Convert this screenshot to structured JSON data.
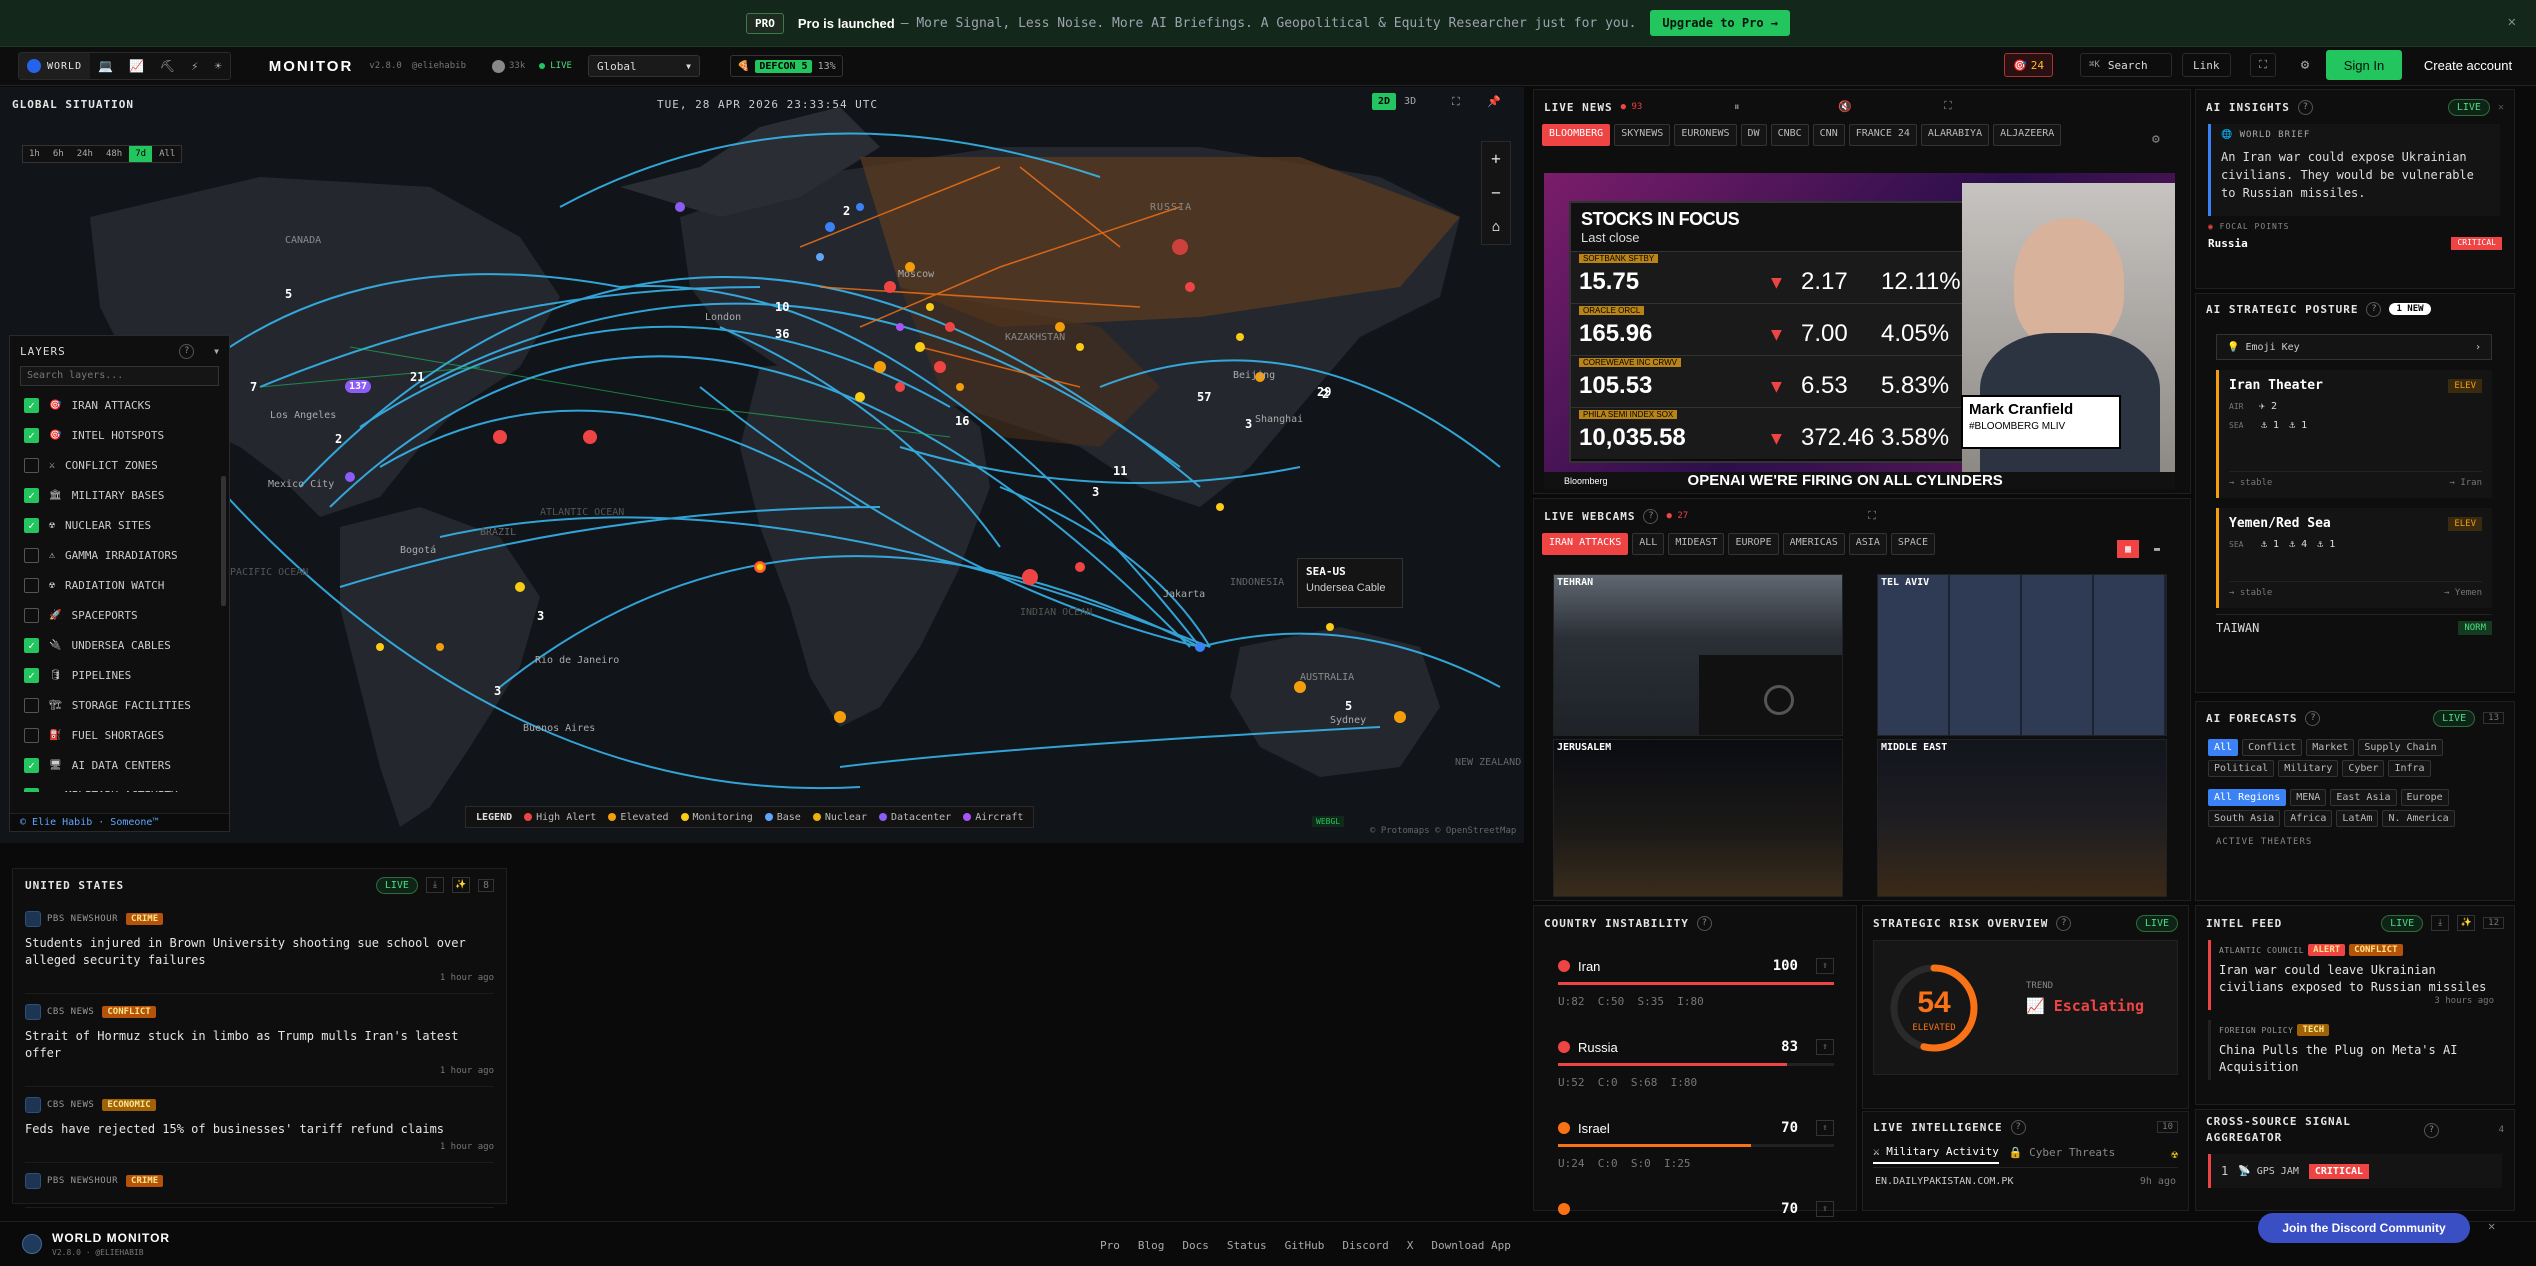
{
  "banner": {
    "tag": "PRO",
    "title": "Pro is launched",
    "text": "— More Signal, Less Noise. More AI Briefings. A Geopolitical & Equity Researcher just for you.",
    "cta": "Upgrade to Pro →",
    "close": "✕"
  },
  "header": {
    "variants": [
      "WORLD",
      "",
      "",
      "",
      "",
      ""
    ],
    "brand": "MONITOR",
    "version": "v2.8.0",
    "handle": "@eliehabib",
    "github": "33k",
    "live": "LIVE",
    "region": "Global",
    "defcon": "DEFCON 5",
    "defcon_pct": "13%",
    "alerts": "24",
    "search_key": "⌘K",
    "search": "Search",
    "link": "Link",
    "signin": "Sign In",
    "create": "Create account"
  },
  "map": {
    "title": "GLOBAL SITUATION",
    "datetime": "TUE, 28 APR 2026 23:33:54 UTC",
    "time_ranges": [
      "1h",
      "6h",
      "24h",
      "48h",
      "7d",
      "All"
    ],
    "active_range": "7d",
    "mode_2d": "2D",
    "mode_3d": "3D",
    "zoom_in": "+",
    "zoom_out": "−",
    "home": "⌂",
    "regions": {
      "russia": "RUSSIA",
      "kazakhstan": "KAZAKHSTAN",
      "canada": "CANADA",
      "pacific": "PACIFIC OCEAN",
      "atlantic": "ATLANTIC OCEAN",
      "indian": "INDIAN OCEAN",
      "australia": "AUSTRALIA",
      "new_zealand": "NEW ZEALAND",
      "indonesia": "INDONESIA",
      "brazil": "BRAZIL"
    },
    "cities": [
      "Los Angeles",
      "Mexico City",
      "Bogotá",
      "Rio de Janeiro",
      "Buenos Aires",
      "Moscow",
      "Beijing",
      "Shanghai",
      "Jakarta",
      "Sydney",
      "London"
    ],
    "clusters": [
      "137",
      "21",
      "7",
      "5",
      "2",
      "36",
      "10",
      "2",
      "16",
      "57",
      "3",
      "29",
      "11",
      "3",
      "3",
      "5",
      "3",
      "2"
    ],
    "tooltip": {
      "title": "SEA-US",
      "subtitle": "Undersea Cable"
    },
    "legend": {
      "title": "LEGEND",
      "items": [
        {
          "label": "High Alert",
          "color": "#ef4444"
        },
        {
          "label": "Elevated",
          "color": "#f59e0b"
        },
        {
          "label": "Monitoring",
          "color": "#facc15"
        },
        {
          "label": "Base",
          "color": "#60a5fa"
        },
        {
          "label": "Nuclear",
          "color": "#eab308"
        },
        {
          "label": "Datacenter",
          "color": "#8b5cf6"
        },
        {
          "label": "Aircraft",
          "color": "#a855f7"
        }
      ]
    },
    "webgl": "WEBGL",
    "attribution": "© Protomaps © OpenStreetMap",
    "layers": {
      "title": "LAYERS",
      "help": "?",
      "search_placeholder": "Search layers...",
      "items": [
        {
          "label": "IRAN ATTACKS",
          "on": true,
          "icon": "🎯"
        },
        {
          "label": "INTEL HOTSPOTS",
          "on": true,
          "icon": "🎯"
        },
        {
          "label": "CONFLICT ZONES",
          "on": false,
          "icon": "⚔"
        },
        {
          "label": "MILITARY BASES",
          "on": true,
          "icon": "🏛"
        },
        {
          "label": "NUCLEAR SITES",
          "on": true,
          "icon": "☢"
        },
        {
          "label": "GAMMA IRRADIATORS",
          "on": false,
          "icon": "⚠"
        },
        {
          "label": "RADIATION WATCH",
          "on": false,
          "icon": "☢"
        },
        {
          "label": "SPACEPORTS",
          "on": false,
          "icon": "🚀"
        },
        {
          "label": "UNDERSEA CABLES",
          "on": true,
          "icon": "🔌"
        },
        {
          "label": "PIPELINES",
          "on": true,
          "icon": "🛢"
        },
        {
          "label": "STORAGE FACILITIES",
          "on": false,
          "icon": "🏗"
        },
        {
          "label": "FUEL SHORTAGES",
          "on": false,
          "icon": "⛽"
        },
        {
          "label": "AI DATA CENTERS",
          "on": true,
          "icon": "🖥"
        },
        {
          "label": "MILITARY ACTIVITY",
          "on": true,
          "icon": "✈"
        }
      ],
      "footer": "© Elie Habib · Someone™"
    }
  },
  "us_panel": {
    "title": "UNITED STATES",
    "live": "LIVE",
    "count": "8",
    "items": [
      {
        "source": "PBS NEWSHOUR",
        "cat": "CRIME",
        "headline": "Students injured in Brown University shooting sue school over alleged security failures",
        "time": "1 hour ago"
      },
      {
        "source": "CBS NEWS",
        "cat": "CONFLICT",
        "headline": "Strait of Hormuz stuck in limbo as Trump mulls Iran's latest offer",
        "time": "1 hour ago"
      },
      {
        "source": "CBS NEWS",
        "cat": "ECONOMIC",
        "headline": "Feds have rejected 15% of businesses' tariff refund claims",
        "time": "1 hour ago"
      },
      {
        "source": "PBS NEWSHOUR",
        "cat": "CRIME",
        "headline": "",
        "time": ""
      }
    ]
  },
  "live_news": {
    "title": "LIVE NEWS",
    "count": "93",
    "channels": [
      "BLOOMBERG",
      "SKYNEWS",
      "EURONEWS",
      "DW",
      "CNBC",
      "CNN",
      "FRANCE 24",
      "ALARABIYA",
      "ALJAZEERA"
    ],
    "active": "BLOOMBERG",
    "video": {
      "heading": "STOCKS IN FOCUS",
      "sub": "Last close",
      "rows": [
        {
          "name": "SOFTBANK",
          "ticker": "SFTBY",
          "price": "15.75",
          "chg": "2.17",
          "pct": "12.11%"
        },
        {
          "name": "ORACLE",
          "ticker": "ORCL",
          "price": "165.96",
          "chg": "7.00",
          "pct": "4.05%"
        },
        {
          "name": "COREWEAVE INC",
          "ticker": "CRWV",
          "price": "105.53",
          "chg": "6.53",
          "pct": "5.83%"
        },
        {
          "name": "PHILA SEMI INDEX",
          "ticker": "SOX",
          "price": "10,035.58",
          "chg": "372.46",
          "pct": "3.58%"
        }
      ],
      "anchor": "Mark Cranfield",
      "anchor_title": "#BLOOMBERG MLIV",
      "ticker": "OPENAI WE'RE FIRING ON ALL CYLINDERS",
      "logo": "Bloomberg"
    }
  },
  "webcams": {
    "title": "LIVE WEBCAMS",
    "count": "27",
    "tabs": [
      "IRAN ATTACKS",
      "ALL",
      "MIDEAST",
      "EUROPE",
      "AMERICAS",
      "ASIA",
      "SPACE"
    ],
    "active": "IRAN ATTACKS",
    "cams": [
      "TEHRAN",
      "TEL AVIV",
      "JERUSALEM",
      "MIDDLE EAST"
    ]
  },
  "ai_insights": {
    "title": "AI INSIGHTS",
    "live": "LIVE",
    "brief_label": "WORLD BRIEF",
    "brief": "An Iran war could expose Ukrainian civilians. They would be vulnerable to Russian missiles.",
    "focal": "FOCAL POINTS",
    "focal_item": "Russia",
    "focal_badge": "CRITICAL"
  },
  "posture": {
    "title": "AI STRATEGIC POSTURE",
    "new": "1 NEW",
    "emoji_key": "Emoji Key",
    "theaters": [
      {
        "name": "Iran Theater",
        "level": "ELEV",
        "air_label": "AIR",
        "air": [
          "2"
        ],
        "sea_label": "SEA",
        "sea": [
          "1",
          "1"
        ],
        "trend": "→ stable",
        "link": "→ Iran"
      },
      {
        "name": "Yemen/Red Sea",
        "level": "ELEV",
        "sea_label": "SEA",
        "sea": [
          "1",
          "4",
          "1"
        ],
        "trend": "→ stable",
        "link": "→ Yemen"
      }
    ],
    "taiwan": "TAIWAN",
    "taiwan_level": "NORM"
  },
  "forecasts": {
    "title": "AI FORECASTS",
    "live": "LIVE",
    "count": "13",
    "cats": [
      "All",
      "Conflict",
      "Market",
      "Supply Chain",
      "Political",
      "Military",
      "Cyber",
      "Infra"
    ],
    "regions": [
      "All Regions",
      "MENA",
      "East Asia",
      "Europe",
      "South Asia",
      "Africa",
      "LatAm",
      "N. America"
    ],
    "footer": "ACTIVE THEATERS"
  },
  "instability": {
    "title": "COUNTRY INSTABILITY",
    "rows": [
      {
        "name": "Iran",
        "score": "100",
        "score_num": 100,
        "color": "#ef4444",
        "detail": "U:82  C:50  S:35  I:80"
      },
      {
        "name": "Russia",
        "score": "83",
        "score_num": 83,
        "color": "#ef4444",
        "detail": "U:52  C:0  S:68  I:80"
      },
      {
        "name": "Israel",
        "score": "70",
        "score_num": 70,
        "color": "#f97316",
        "detail": "U:24  C:0  S:0  I:25"
      },
      {
        "name": "",
        "score": "70",
        "score_num": 70,
        "color": "#f97316",
        "detail": ""
      }
    ]
  },
  "risk": {
    "title": "STRATEGIC RISK OVERVIEW",
    "live": "LIVE",
    "score": "54",
    "score_num": 54,
    "label": "ELEVATED",
    "trend_label": "TREND",
    "trend": "Escalating"
  },
  "intel": {
    "title": "LIVE INTELLIGENCE",
    "count": "10",
    "tabs": [
      "Military Activity",
      "Cyber Threats"
    ],
    "item": "EN.DAILYPAKISTAN.COM.PK",
    "time": "9h ago"
  },
  "feed": {
    "title": "INTEL FEED",
    "live": "LIVE",
    "count": "12",
    "items": [
      {
        "source": "ATLANTIC COUNCIL",
        "badges": [
          "ALERT",
          "CONFLICT"
        ],
        "headline": "Iran war could leave Ukrainian civilians exposed to Russian missiles",
        "time": "3 hours ago"
      },
      {
        "source": "FOREIGN POLICY",
        "badges": [
          "TECH"
        ],
        "headline": "China Pulls the Plug on Meta's AI Acquisition",
        "time": ""
      }
    ]
  },
  "aggregator": {
    "title": "CROSS-SOURCE SIGNAL AGGREGATOR",
    "count": "4",
    "item_num": "1",
    "item": "GPS JAM",
    "badge": "CRITICAL"
  },
  "footer": {
    "brand": "WORLD MONITOR",
    "sub": "V2.8.0 · @ELIEHABIB",
    "links": [
      "Pro",
      "Blog",
      "Docs",
      "Status",
      "GitHub",
      "Discord",
      "X",
      "Download App"
    ],
    "discord": "Join the Discord Community",
    "discord_close": "✕"
  },
  "colors": {
    "accent": "#22c55e",
    "danger": "#ef4444",
    "warn": "#f59e0b",
    "cable": "#38bdf8",
    "info": "#3b82f6"
  }
}
